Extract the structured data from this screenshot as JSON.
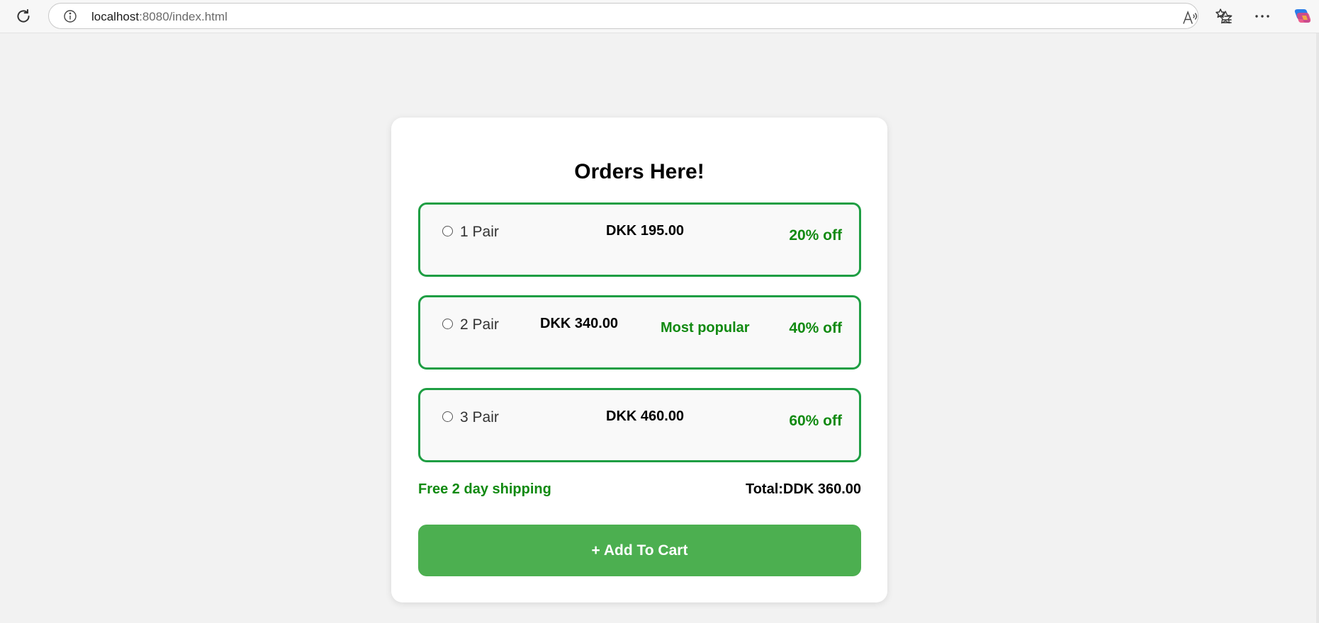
{
  "browser": {
    "url_host": "localhost",
    "url_rest": ":8080/index.html",
    "icons": {
      "reload": "reload-icon",
      "info": "info-icon",
      "read_aloud": "read-aloud-icon",
      "favorite": "star-icon",
      "favorites": "favorites-list-icon",
      "more": "more-icon",
      "copilot": "copilot-icon"
    }
  },
  "order": {
    "title": "Orders Here!",
    "options": [
      {
        "label": "1 Pair",
        "price": "DKK 195.00",
        "badge": "",
        "discount": "20% off",
        "selected": false
      },
      {
        "label": "2 Pair",
        "price": "DKK 340.00",
        "badge": "Most popular",
        "discount": "40% off",
        "selected": false
      },
      {
        "label": "3 Pair",
        "price": "DKK 460.00",
        "badge": "",
        "discount": "60% off",
        "selected": false
      }
    ],
    "shipping": "Free 2 day shipping",
    "total": "Total:DDK 360.00",
    "add_to_cart": "+ Add To Cart"
  },
  "colors": {
    "accent_green": "#1e9e43",
    "text_green": "#118a11",
    "button_green": "#4caf50",
    "page_background": "#f2f2f2"
  }
}
